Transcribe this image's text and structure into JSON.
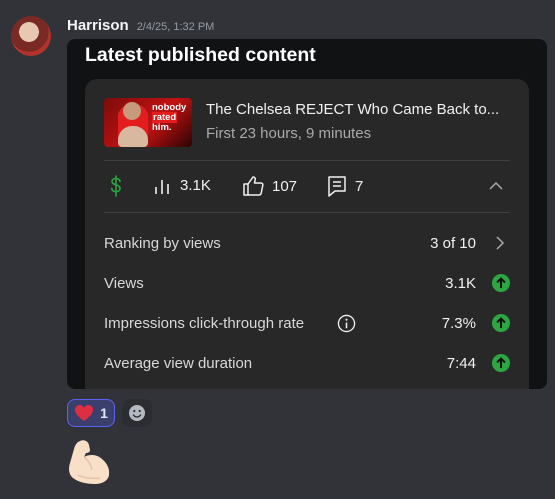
{
  "message": {
    "author": "Harrison",
    "timestamp": "2/4/25, 1:32 PM"
  },
  "embed": {
    "title": "Latest published content",
    "video": {
      "thumbnail_caption": [
        "nobody",
        "rated",
        "him."
      ],
      "title": "The Chelsea REJECT Who Came Back to...",
      "subtitle": "First 23 hours, 9 minutes"
    },
    "stats": {
      "revenue_icon": "dollar-icon",
      "views_icon": "bar-chart-icon",
      "views": "3.1K",
      "likes_icon": "thumbs-up-icon",
      "likes": "107",
      "comments_icon": "comment-icon",
      "comments": "7"
    },
    "metrics": [
      {
        "label": "Ranking by views",
        "value": "3 of 10"
      },
      {
        "label": "Views",
        "value": "3.1K"
      },
      {
        "label": "Impressions click-through rate",
        "value": "7.3%"
      },
      {
        "label": "Average view duration",
        "value": "7:44"
      }
    ]
  },
  "reactions": [
    {
      "emoji": "heart",
      "count": "1"
    }
  ],
  "colors": {
    "background": "#313338",
    "embed": "#111214",
    "card": "#282828",
    "positive": "#2ba640",
    "revenue": "#2ba640",
    "reaction_border": "#5865f2"
  }
}
